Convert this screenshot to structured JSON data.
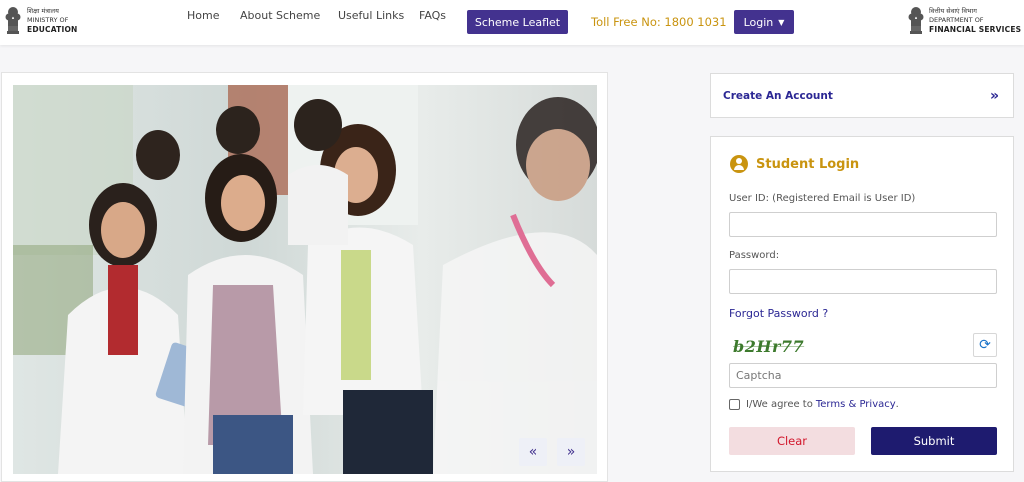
{
  "header": {
    "left_logo": {
      "line1": "शिक्षा मंत्रालय",
      "line2": "MINISTRY OF",
      "line3": "EDUCATION"
    },
    "nav": {
      "home": "Home",
      "about": "About Scheme",
      "useful_links": "Useful Links",
      "faqs": "FAQs"
    },
    "leaflet_button": "Scheme Leaflet",
    "toll_free": "Toll Free No: 1800 1031",
    "login_button": "Login",
    "right_logo": {
      "line1": "वित्तीय सेवाएं विभाग",
      "line2": "DEPARTMENT OF",
      "line3": "FINANCIAL SERVICES"
    }
  },
  "slider": {
    "prev_label": "«",
    "next_label": "»"
  },
  "create_account": {
    "label": "Create An Account",
    "icon": "double-chevron-right-icon"
  },
  "login": {
    "title": "Student Login",
    "user_id_label": "User ID: (Registered Email is User ID)",
    "user_id_value": "",
    "password_label": "Password:",
    "password_value": "",
    "forgot": "Forgot Password ?",
    "captcha_text": "b2Hr77",
    "captcha_placeholder": "Captcha",
    "agree_text": "I/We agree to",
    "terms_text": "Terms & Privacy",
    "agree_suffix": ".",
    "clear_button": "Clear",
    "submit_button": "Submit"
  },
  "colors": {
    "brand_purple": "#43328f",
    "gold": "#c99410",
    "link_blue": "#2b2794",
    "submit_navy": "#1e1b6f",
    "clear_red": "#d2162b"
  }
}
